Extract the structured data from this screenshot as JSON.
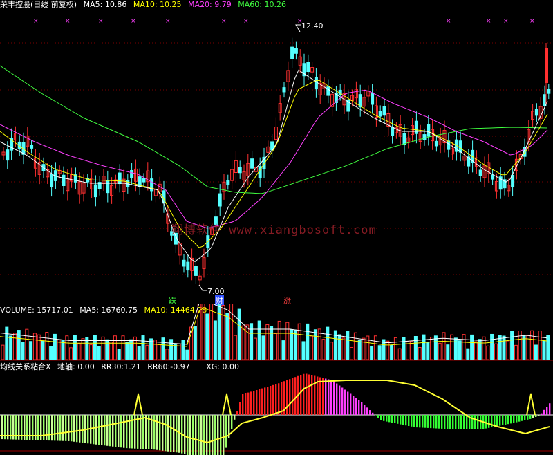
{
  "main_header": {
    "title": "荣丰控股(日线 前复权)",
    "ma5_label": "MA5:",
    "ma5": "10.86",
    "ma10_label": "MA10:",
    "ma10": "10.25",
    "ma20_label": "MA20:",
    "ma20": "9.79",
    "ma60_label": "MA60:",
    "ma60": "10.26"
  },
  "price_chart": {
    "high_label": "12.40",
    "low_label": "7.00",
    "signal_down": "跌",
    "signal_cai": "财",
    "signal_up": "涨",
    "watermark": "翔博软件 www.xiangbosoft.com"
  },
  "volume_header": {
    "volume_label": "VOLUME:",
    "volume": "15717.01",
    "ma5_label": "MA5:",
    "ma5": "16760.75",
    "ma10_label": "MA10:",
    "ma10": "14464.78"
  },
  "indicator_header": {
    "name": "均线关系粘合X",
    "ground_label": "地轴:",
    "ground": "0.00",
    "rr30_label": "RR30:",
    "rr30": "1.21",
    "rr60_label": "RR60:",
    "rr60": "-0.97",
    "xg_label": "XG:",
    "xg": "0.00"
  },
  "colors": {
    "up": "#ff3030",
    "down": "#54ffff",
    "ma5": "#ffffff",
    "ma10": "#ffff00",
    "ma20": "#ff40ff",
    "ma60": "#40ff40",
    "grid": "#7a0000"
  }
}
